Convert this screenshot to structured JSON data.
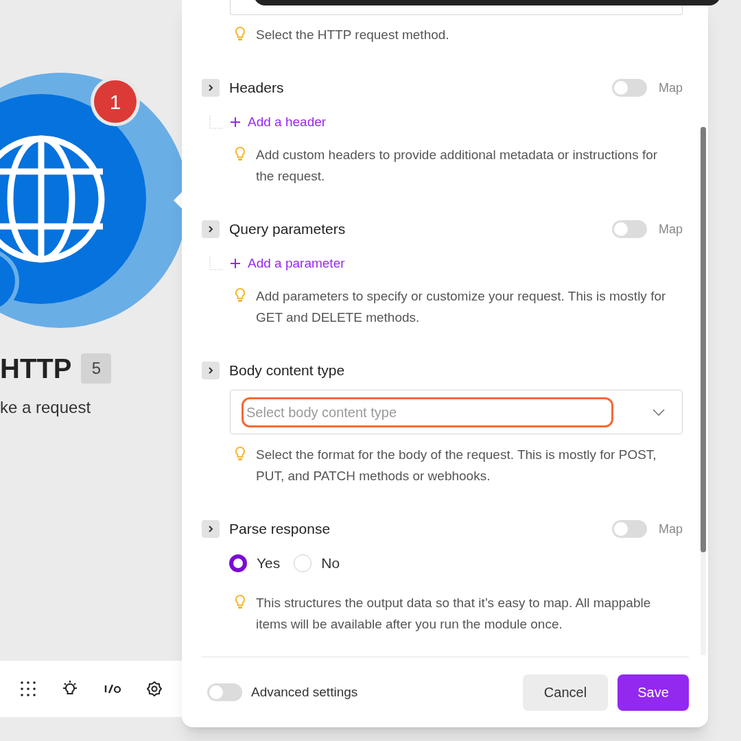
{
  "canvas": {
    "module": {
      "badge": "1",
      "title": "HTTP",
      "count": "5",
      "subtitle": "ke a request"
    }
  },
  "panel": {
    "method_hint": "Select the HTTP request method.",
    "sections": [
      {
        "kind": "list",
        "title": "Headers",
        "map_on": false,
        "map_label": "Map",
        "add_label": "Add a header",
        "hint": "Add custom headers to provide additional metadata or instructions for the request."
      },
      {
        "kind": "list",
        "title": "Query parameters",
        "map_on": false,
        "map_label": "Map",
        "add_label": "Add a parameter",
        "hint": "Add parameters to specify or customize your request. This is mostly for GET and DELETE methods."
      },
      {
        "kind": "select",
        "title": "Body content type",
        "placeholder": "Select body content type",
        "highlighted": true,
        "hint": "Select the format for the body of the request. This is mostly for POST, PUT, and PATCH methods or webhooks."
      },
      {
        "kind": "radio",
        "title": "Parse response",
        "map_on": false,
        "map_label": "Map",
        "options": [
          {
            "label": "Yes",
            "selected": true
          },
          {
            "label": "No",
            "selected": false
          }
        ],
        "hint": "This structures the output data so that it’s easy to map. All mappable items will be available after you run the module once."
      }
    ],
    "footer": {
      "advanced_label": "Advanced settings",
      "advanced_on": false,
      "cancel": "Cancel",
      "save": "Save"
    }
  }
}
